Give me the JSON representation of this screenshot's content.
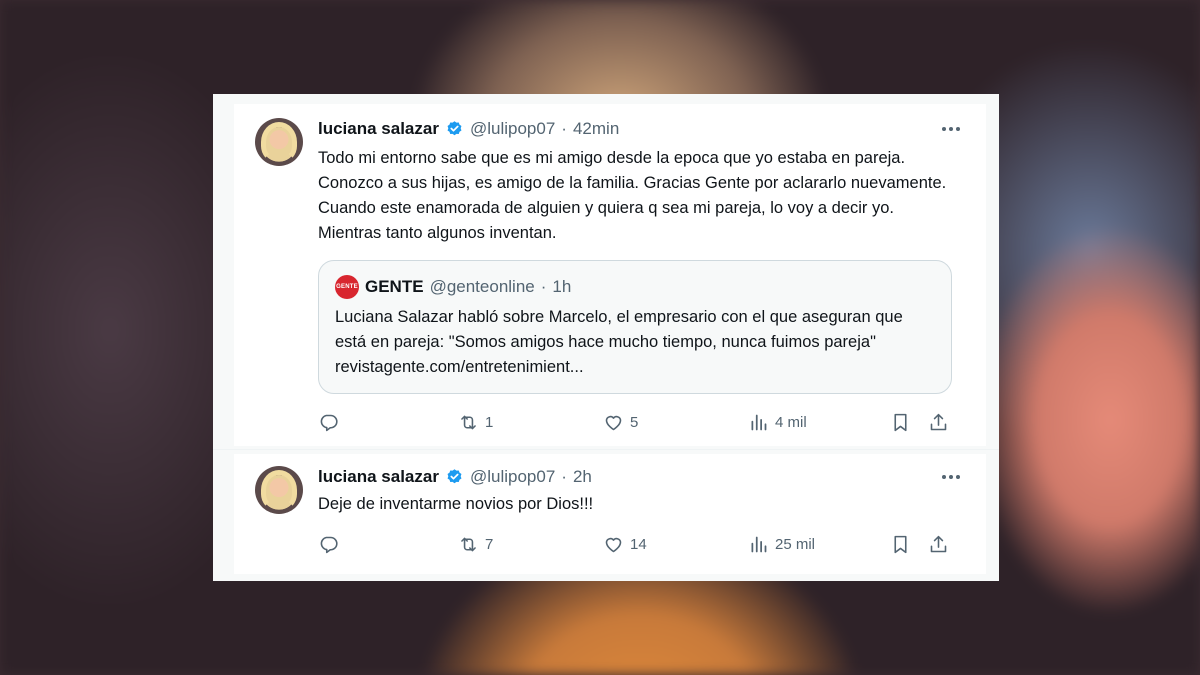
{
  "tweets": [
    {
      "name": "luciana salazar",
      "handle": "@lulipop07",
      "dot": "·",
      "time": "42min",
      "text": "Todo mi entorno sabe que es mi amigo desde la epoca que yo estaba en pareja. Conozco a sus hijas, es amigo de la familia. Gracias Gente por aclararlo nuevamente. Cuando este enamorada de alguien y quiera q sea mi pareja, lo voy a decir yo. Mientras tanto algunos inventan.",
      "quote": {
        "logo_text": "GENTE",
        "name": "GENTE",
        "handle": "@genteonline",
        "dot": "·",
        "time": "1h",
        "text": "Luciana Salazar habló sobre Marcelo, el empresario con el que aseguran que está en pareja: \"Somos amigos hace mucho tiempo, nunca fuimos pareja\" revistagente.com/entretenimient..."
      },
      "replies": "",
      "retweets": "1",
      "likes": "5",
      "views": "4 mil"
    },
    {
      "name": "luciana salazar",
      "handle": "@lulipop07",
      "dot": "·",
      "time": "2h",
      "text": "Deje de inventarme novios por Dios!!!",
      "replies": "",
      "retweets": "7",
      "likes": "14",
      "views": "25 mil"
    }
  ],
  "colors": {
    "verified": "#1d9bf0",
    "secondary_text": "#536471",
    "primary_text": "#0f1419",
    "gente_brand": "#d8262f"
  },
  "icons": [
    "verified-badge-icon",
    "more-icon",
    "reply-icon",
    "retweet-icon",
    "like-icon",
    "views-icon",
    "bookmark-icon",
    "share-icon"
  ]
}
